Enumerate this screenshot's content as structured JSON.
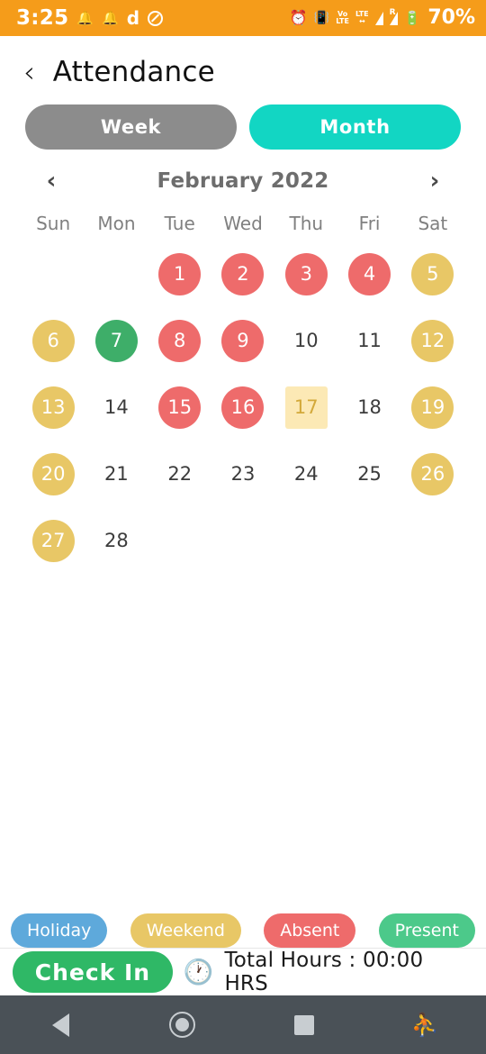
{
  "status_bar": {
    "background": "#F59C1A",
    "time": "3:25",
    "battery_percent": "70%",
    "left_icons": [
      "bell-icon",
      "bell-icon",
      "dnd-letter-icon",
      "do-not-disturb-icon"
    ],
    "right_icons": [
      "alarm-icon",
      "vibrate-icon",
      "volte-icon",
      "lte-icon",
      "signal-icon",
      "signal-roaming-icon",
      "battery-icon"
    ],
    "dnd_letter": "d",
    "volte_top": "Vo",
    "volte_bottom": "LTE",
    "lte_label": "LTE",
    "lte_sub": "↔",
    "roaming_label": "R"
  },
  "header": {
    "back_label": "‹",
    "title": "Attendance"
  },
  "segmented": {
    "options": [
      {
        "label": "Week",
        "active": false,
        "color": "#8c8c8c"
      },
      {
        "label": "Month",
        "active": true,
        "color": "#12D6C3"
      }
    ]
  },
  "calendar": {
    "prev_label": "‹",
    "next_label": "›",
    "month_label": "February 2022",
    "day_headers": [
      "Sun",
      "Mon",
      "Tue",
      "Wed",
      "Thu",
      "Fri",
      "Sat"
    ],
    "weeks": [
      [
        {
          "day": "",
          "state": "empty"
        },
        {
          "day": "",
          "state": "empty"
        },
        {
          "day": "1",
          "state": "absent"
        },
        {
          "day": "2",
          "state": "absent"
        },
        {
          "day": "3",
          "state": "absent"
        },
        {
          "day": "4",
          "state": "absent"
        },
        {
          "day": "5",
          "state": "weekend"
        }
      ],
      [
        {
          "day": "6",
          "state": "weekend"
        },
        {
          "day": "7",
          "state": "present"
        },
        {
          "day": "8",
          "state": "absent"
        },
        {
          "day": "9",
          "state": "absent"
        },
        {
          "day": "10",
          "state": "plain"
        },
        {
          "day": "11",
          "state": "plain"
        },
        {
          "day": "12",
          "state": "weekend"
        }
      ],
      [
        {
          "day": "13",
          "state": "weekend"
        },
        {
          "day": "14",
          "state": "plain"
        },
        {
          "day": "15",
          "state": "absent"
        },
        {
          "day": "16",
          "state": "absent"
        },
        {
          "day": "17",
          "state": "today"
        },
        {
          "day": "18",
          "state": "plain"
        },
        {
          "day": "19",
          "state": "weekend"
        }
      ],
      [
        {
          "day": "20",
          "state": "weekend"
        },
        {
          "day": "21",
          "state": "plain"
        },
        {
          "day": "22",
          "state": "plain"
        },
        {
          "day": "23",
          "state": "plain"
        },
        {
          "day": "24",
          "state": "plain"
        },
        {
          "day": "25",
          "state": "plain"
        },
        {
          "day": "26",
          "state": "weekend"
        }
      ],
      [
        {
          "day": "27",
          "state": "weekend"
        },
        {
          "day": "28",
          "state": "plain"
        },
        {
          "day": "",
          "state": "empty"
        },
        {
          "day": "",
          "state": "empty"
        },
        {
          "day": "",
          "state": "empty"
        },
        {
          "day": "",
          "state": "empty"
        },
        {
          "day": "",
          "state": "empty"
        }
      ]
    ]
  },
  "legend": [
    {
      "label": "Holiday",
      "color": "#5EA9DB"
    },
    {
      "label": "Weekend",
      "color": "#E8C766"
    },
    {
      "label": "Absent",
      "color": "#EE6B6B"
    },
    {
      "label": "Present",
      "color": "#4CC98A"
    }
  ],
  "bottom_bar": {
    "check_in_label": "Check In",
    "clock_icon": "clock-icon",
    "total_hours_label": "Total Hours : 00:00 HRS"
  },
  "nav_bar": {
    "items": [
      "back-nav-icon",
      "home-nav-icon",
      "recents-nav-icon",
      "accessibility-nav-icon"
    ],
    "accessibility_glyph": "⛹"
  }
}
